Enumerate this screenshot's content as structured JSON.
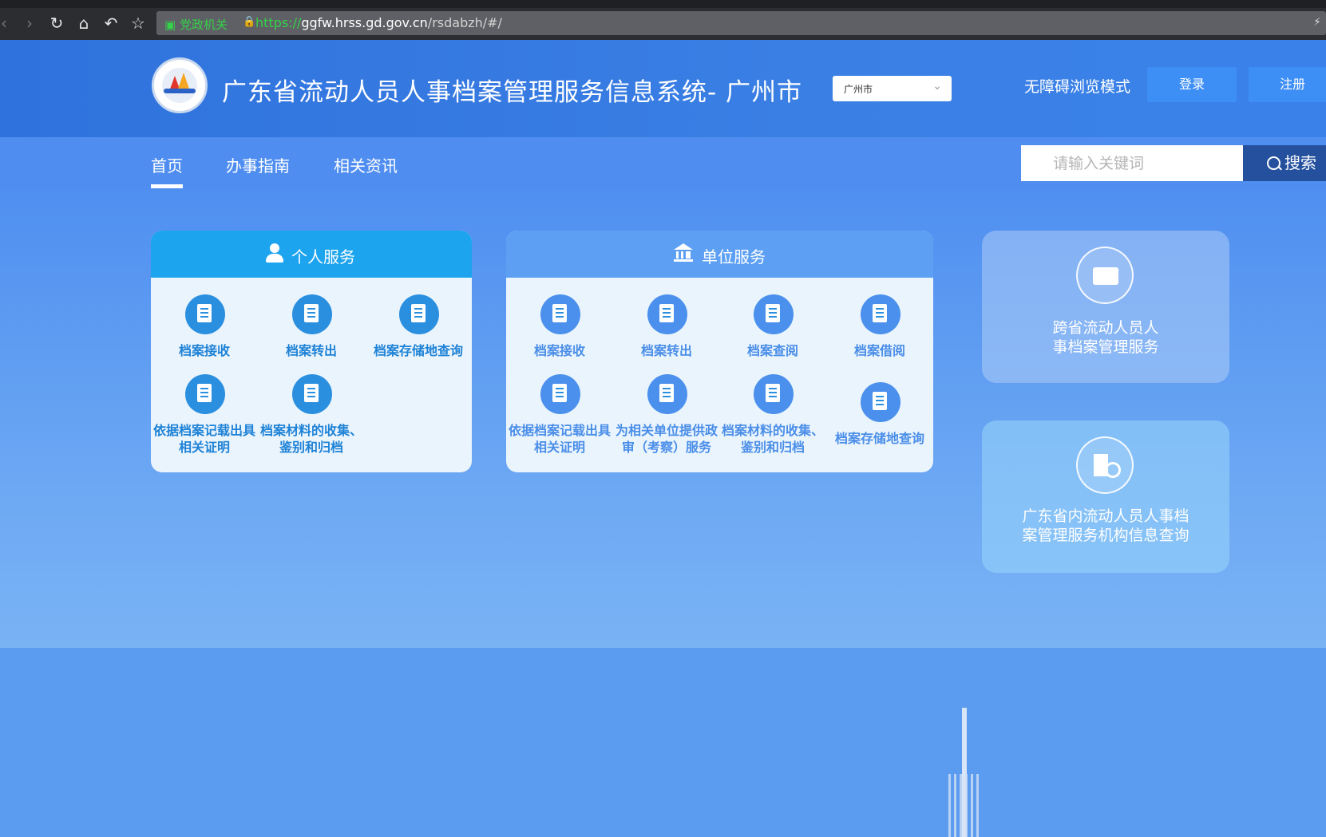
{
  "browser": {
    "gov_badge": "党政机关",
    "url_protocol": "https://",
    "url_host": "ggfw.hrss.gd.gov.cn",
    "url_path": "/rsdabzh/#/"
  },
  "header": {
    "title": "广东省流动人员人事档案管理服务信息系统- 广州市",
    "city_select": "广州市",
    "accessibility": "无障碍浏览模式",
    "login": "登录",
    "register": "注册"
  },
  "nav": {
    "items": [
      {
        "label": "首页",
        "active": true
      },
      {
        "label": "办事指南",
        "active": false
      },
      {
        "label": "相关资讯",
        "active": false
      }
    ],
    "search_placeholder": "请输入关键词",
    "search_button": "搜索"
  },
  "personal": {
    "title": "个人服务",
    "items": [
      {
        "line1": "档案接收",
        "line2": ""
      },
      {
        "line1": "档案转出",
        "line2": ""
      },
      {
        "line1": "档案存储地查询",
        "line2": ""
      },
      {
        "line1": "依据档案记载出具",
        "line2": "相关证明"
      },
      {
        "line1": "档案材料的收集、",
        "line2": "鉴别和归档"
      }
    ]
  },
  "unit": {
    "title": "单位服务",
    "items": [
      {
        "line1": "档案接收",
        "line2": ""
      },
      {
        "line1": "档案转出",
        "line2": ""
      },
      {
        "line1": "档案查阅",
        "line2": ""
      },
      {
        "line1": "档案借阅",
        "line2": ""
      },
      {
        "line1": "依据档案记载出具",
        "line2": "相关证明"
      },
      {
        "line1": "为相关单位提供政",
        "line2": "审（考察）服务"
      },
      {
        "line1": "档案材料的收集、",
        "line2": "鉴别和归档"
      },
      {
        "line1": "档案存储地查询",
        "line2": ""
      }
    ]
  },
  "cards": [
    {
      "line1": "跨省流动人员人",
      "line2": "事档案管理服务"
    },
    {
      "line1": "广东省内流动人员人事档",
      "line2": "案管理服务机构信息查询"
    }
  ]
}
